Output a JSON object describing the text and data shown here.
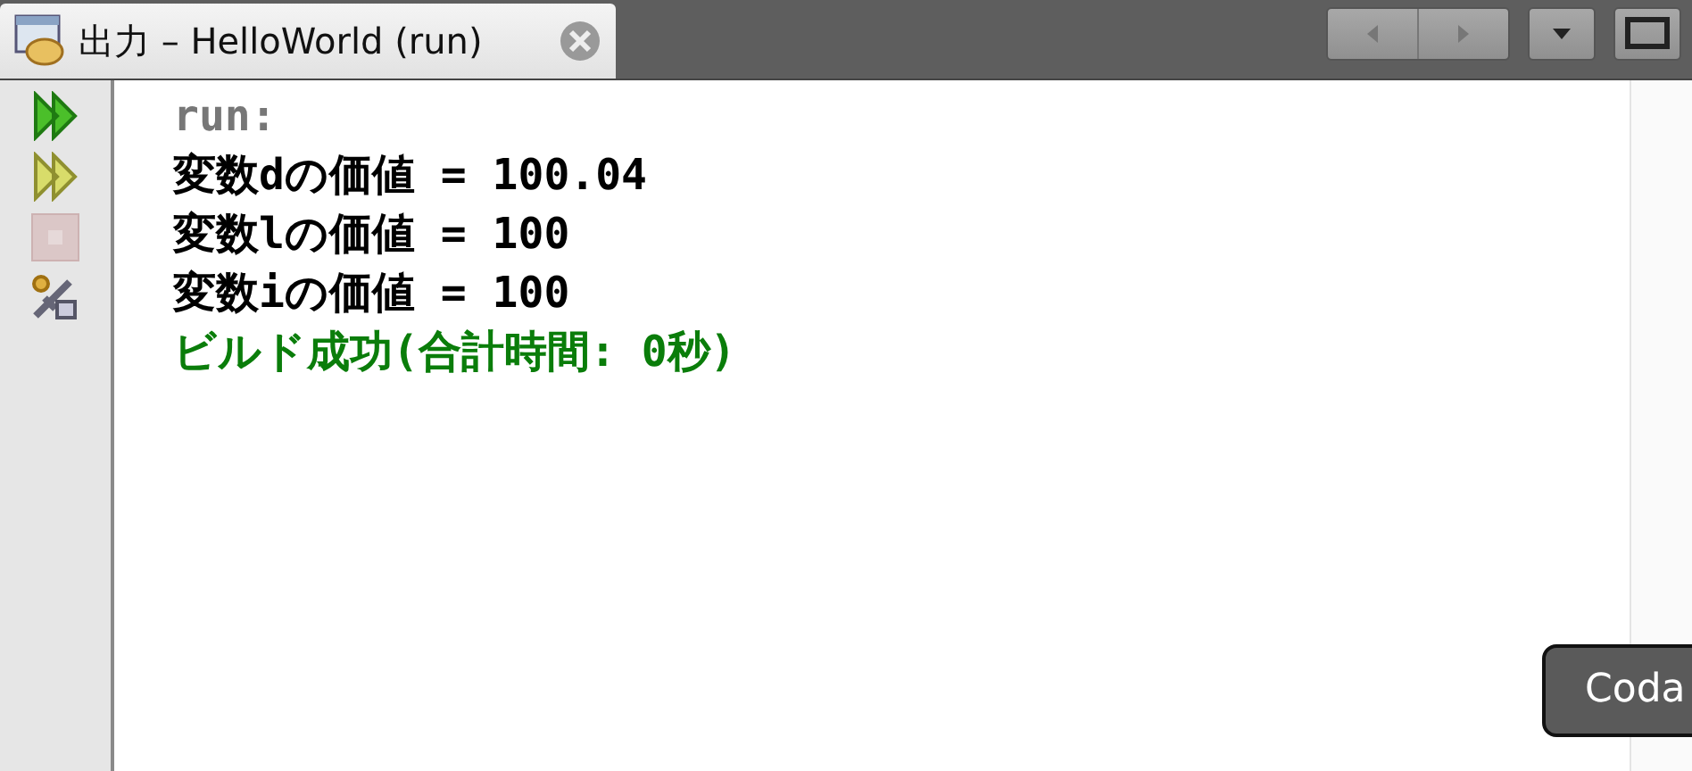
{
  "tab": {
    "title": "出力 – HelloWorld (run)",
    "selected": true
  },
  "toolbar": [
    {
      "kind": "rerun",
      "disabled": false
    },
    {
      "kind": "rerun-custom",
      "disabled": false
    },
    {
      "kind": "stop",
      "disabled": true
    },
    {
      "kind": "settings",
      "disabled": false
    }
  ],
  "output": [
    {
      "kind": "info",
      "text": "run:"
    },
    {
      "kind": "normal",
      "text": "変数dの価値 = 100.04"
    },
    {
      "kind": "normal",
      "text": "変数lの価値 = 100"
    },
    {
      "kind": "normal",
      "text": "変数iの価値 = 100"
    },
    {
      "kind": "success",
      "text": "ビルド成功(合計時間: 0秒)"
    }
  ],
  "tooltip": {
    "text": "Coda"
  }
}
